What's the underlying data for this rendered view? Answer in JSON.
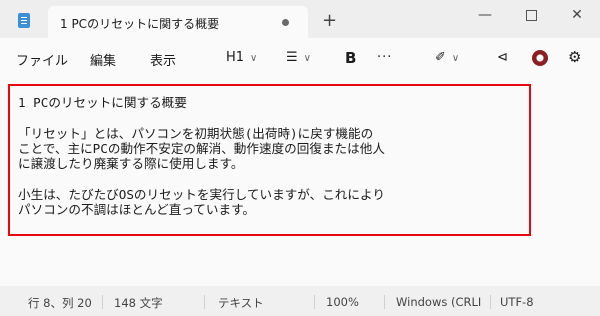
{
  "window": {
    "tab_title": "1 PCのリセットに関する概要",
    "new_tab": "+",
    "minimize": "—",
    "close": "✕"
  },
  "menu": {
    "file": "ファイル",
    "edit": "編集",
    "view": "表示"
  },
  "toolbar": {
    "heading": "H1",
    "chevron": "∨",
    "list_icon": "☰",
    "bold": "B",
    "more": "···",
    "brush_icon": "✐",
    "pin_icon": "⊲",
    "gear_icon": "⚙"
  },
  "document": {
    "lines": [
      "1 PCのリセットに関する概要",
      "「リセット」とは、パソコンを初期状態(出荷時)に戻す機能の",
      "ことで、主にPCの動作不安定の解消、動作速度の回復または他人",
      "に譲渡したり廃棄する際に使用します。",
      "小生は、たびたびOSのリセットを実行していますが、これにより",
      "パソコンの不調はほとんど直っています。"
    ]
  },
  "status": {
    "position": "行 8、列 20",
    "char_count": "148 文字",
    "format": "テキスト",
    "zoom": "100%",
    "line_ending": "Windows (CRLI",
    "encoding": "UTF-8"
  }
}
